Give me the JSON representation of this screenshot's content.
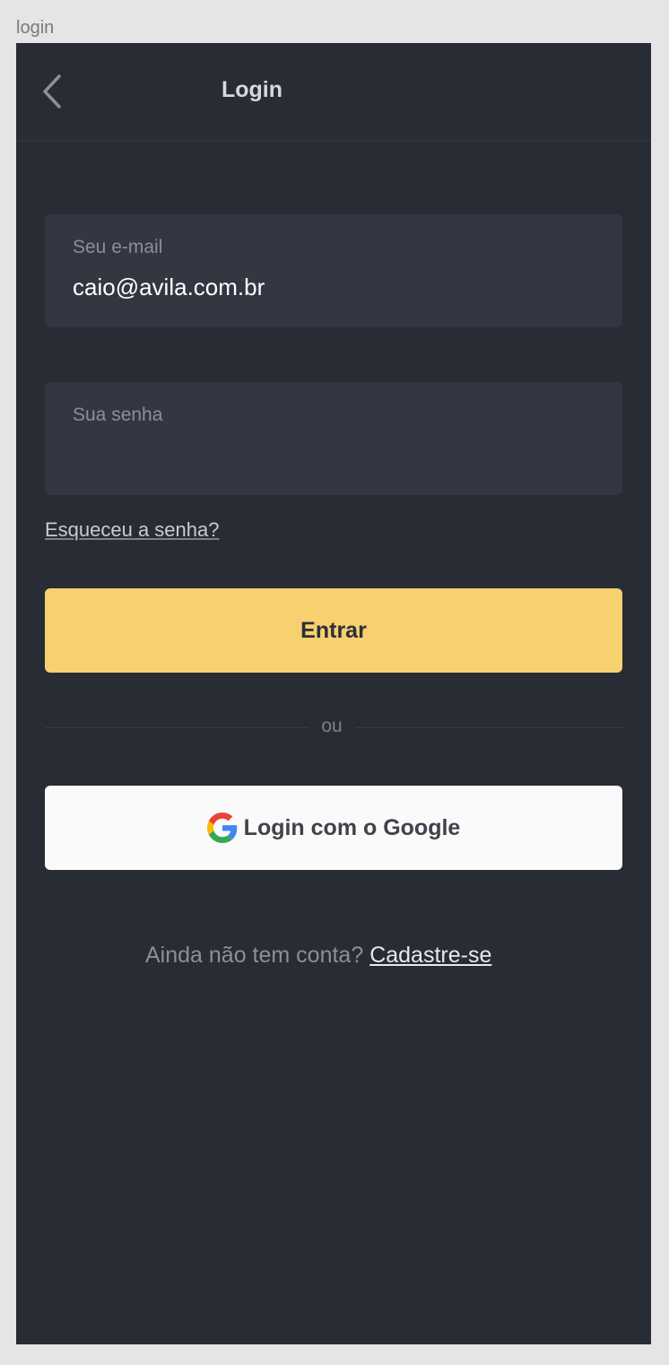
{
  "frame": {
    "label": "login"
  },
  "nav": {
    "title": "Login",
    "back_icon": "chevron-left-icon"
  },
  "form": {
    "email": {
      "label": "Seu e-mail",
      "value": "caio@avila.com.br"
    },
    "password": {
      "label": "Sua senha",
      "value": ""
    },
    "forgot_link": "Esqueceu a senha?",
    "submit_label": "Entrar",
    "divider_text": "ou",
    "google_label": "Login com o Google",
    "google_icon": "google-g-icon"
  },
  "signup": {
    "prompt": "Ainda não tem conta?",
    "link": "Cadastre-se"
  },
  "colors": {
    "background": "#282c35",
    "field": "#333742",
    "primary": "#f7d070",
    "google_button": "#fafafa"
  }
}
